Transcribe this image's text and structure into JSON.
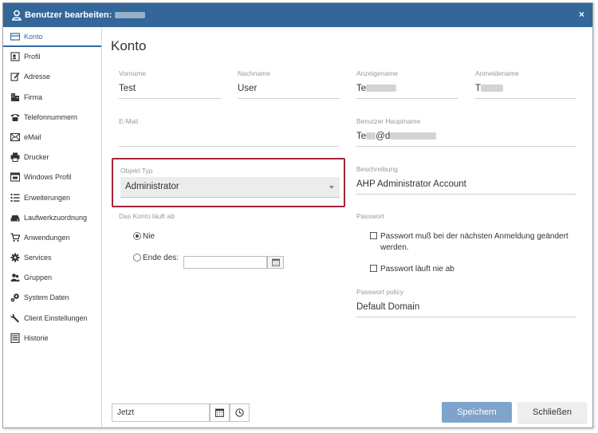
{
  "window": {
    "title": "Benutzer bearbeiten:",
    "close_label": "×",
    "titlebar_color": "#336699"
  },
  "sidebar": {
    "items": [
      {
        "label": "Konto",
        "icon": "card-icon",
        "active": true
      },
      {
        "label": "Profil",
        "icon": "profile-icon"
      },
      {
        "label": "Adresse",
        "icon": "edit-icon"
      },
      {
        "label": "Firma",
        "icon": "building-icon"
      },
      {
        "label": "Telefonnummern",
        "icon": "phone-icon"
      },
      {
        "label": "eMail",
        "icon": "mail-icon"
      },
      {
        "label": "Drucker",
        "icon": "printer-icon"
      },
      {
        "label": "Windows Profil",
        "icon": "window-icon"
      },
      {
        "label": "Erweiterungen",
        "icon": "list-icon"
      },
      {
        "label": "Laufwerkzuordnung",
        "icon": "drive-icon"
      },
      {
        "label": "Anwendungen",
        "icon": "cart-icon"
      },
      {
        "label": "Services",
        "icon": "gear-icon"
      },
      {
        "label": "Gruppen",
        "icon": "users-icon"
      },
      {
        "label": "System Daten",
        "icon": "system-icon"
      },
      {
        "label": "Client Einstellungen",
        "icon": "wrench-icon"
      },
      {
        "label": "Historie",
        "icon": "history-icon"
      }
    ],
    "accent": "#2f6aa7"
  },
  "main": {
    "title": "Konto",
    "vorname": {
      "label": "Vorname",
      "value": "Test"
    },
    "nachname": {
      "label": "Nachname",
      "value": "User"
    },
    "anzeigename": {
      "label": "Anzeigename",
      "value": "Te"
    },
    "anmeldename": {
      "label": "Anmeldename",
      "value": "T"
    },
    "email": {
      "label": "E-Mail",
      "value": ""
    },
    "hauptname": {
      "label": "Benutzer Hauptname",
      "value_start": "Te",
      "value_mid": "@d"
    },
    "objekt_typ": {
      "label": "Objekt Typ",
      "value": "Administrator",
      "highlight_color": "#a8243a"
    },
    "beschreibung": {
      "label": "Beschreibung",
      "value": "AHP Administrator Account"
    },
    "konto_ablauf": {
      "label": "Das Konto läuft ab",
      "option_nie": "Nie",
      "option_ende": "Ende des:",
      "selected": "Nie"
    },
    "passwort": {
      "label": "Passwort",
      "must_change": "Passwort muß bei der nächsten Anmeldung geändert werden.",
      "never_expires": "Passwort läuft nie ab"
    },
    "policy": {
      "label": "Passwort policy",
      "value": "Default Domain"
    }
  },
  "footer": {
    "date_value": "Jetzt",
    "save_label": "Speichern",
    "close_label": "Schließen",
    "save_color": "#7ea4cc"
  }
}
